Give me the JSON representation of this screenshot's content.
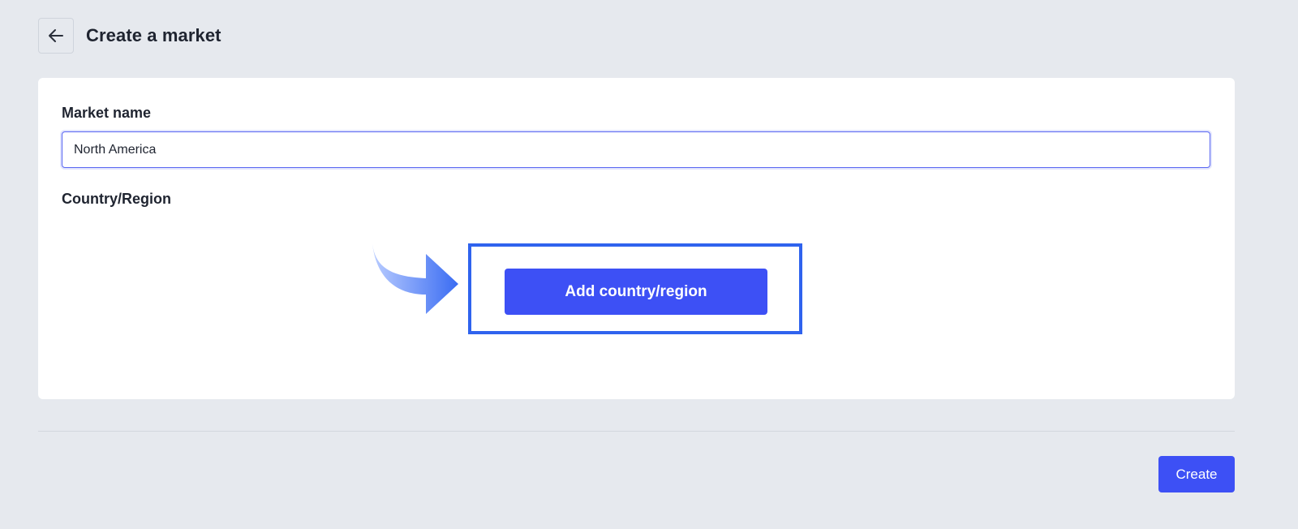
{
  "header": {
    "back_icon": "arrow-left-icon",
    "title": "Create a market"
  },
  "form": {
    "market_name_label": "Market name",
    "market_name_value": "North America",
    "country_region_label": "Country/Region",
    "add_country_label": "Add country/region"
  },
  "annotation": {
    "arrow_icon": "curved-arrow-right-icon",
    "highlight_color": "#2f63ee"
  },
  "footer": {
    "create_label": "Create"
  },
  "colors": {
    "background": "#e6e9ee",
    "card": "#ffffff",
    "primary": "#3d50f5",
    "input_focus": "#5a67f2"
  }
}
